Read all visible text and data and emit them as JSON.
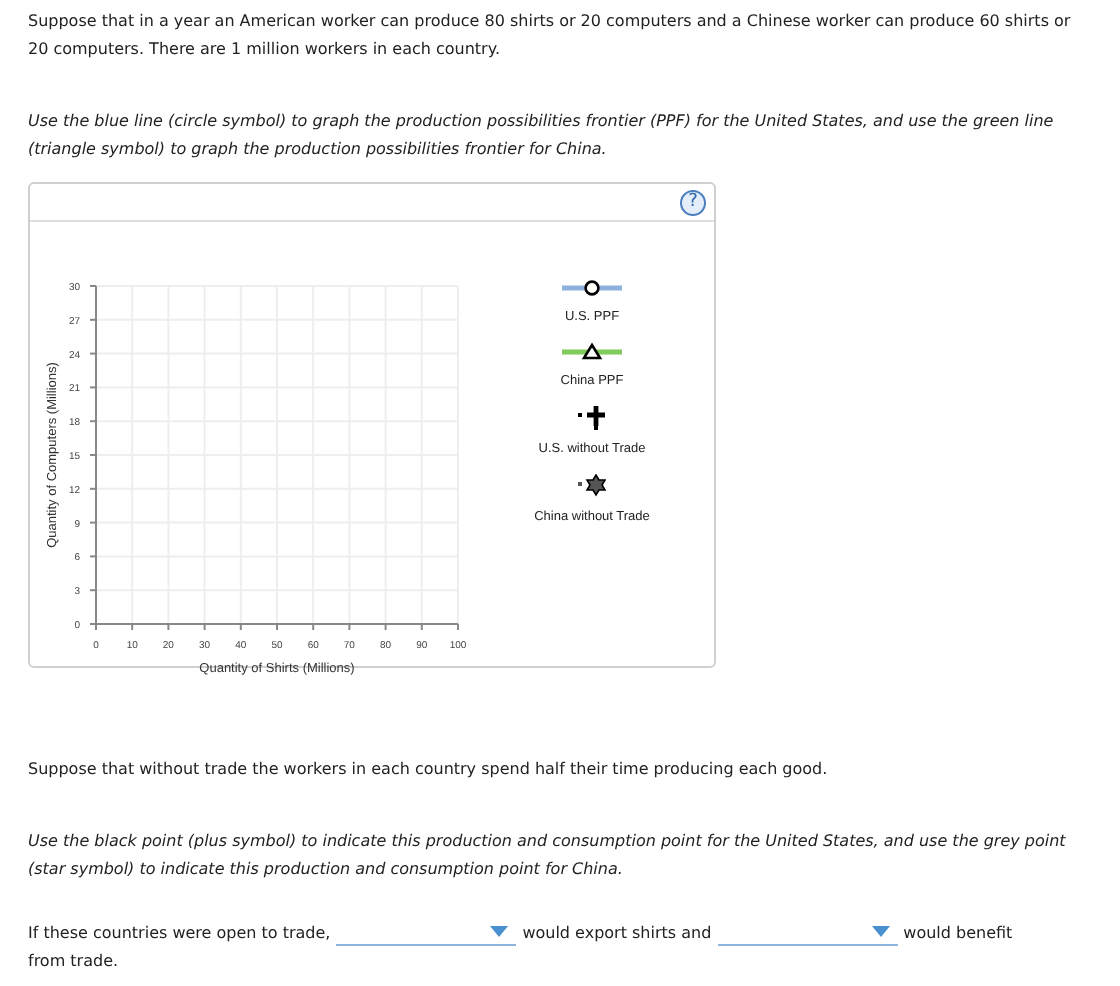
{
  "intro": "Suppose that in a year an American worker can produce 80 shirts or 20 computers and a Chinese worker can produce 60 shirts or 20 computers. There are 1 million workers in each country.",
  "instruction_1": "Use the blue line (circle symbol) to graph the production possibilities frontier (PPF) for the United States, and use the green line (triangle symbol) to graph the production possibilities frontier for China.",
  "graph": {
    "help": "?",
    "chart_data": {
      "type": "line",
      "grid": true,
      "xlabel": "Quantity of Shirts (Millions)",
      "ylabel": "Quantity of Computers (Millions)",
      "xlim": [
        0,
        100
      ],
      "ylim": [
        0,
        30
      ],
      "xticks": [
        0,
        10,
        20,
        30,
        40,
        50,
        60,
        70,
        80,
        90,
        100
      ],
      "yticks": [
        0,
        3,
        6,
        9,
        12,
        15,
        18,
        21,
        24,
        27,
        30
      ]
    },
    "legend": [
      {
        "kind": "circle",
        "label": "U.S. PPF",
        "color": "#8db3dc"
      },
      {
        "kind": "triangle",
        "label": "China PPF",
        "color": "#7fcc5c"
      },
      {
        "kind": "plus",
        "label": "U.S. without Trade",
        "color": "#000000"
      },
      {
        "kind": "star",
        "label": "China without Trade",
        "color": "#555555"
      }
    ]
  },
  "statement": "Suppose that without trade the workers in each country spend half their time producing each good.",
  "instruction_2": "Use the black point (plus symbol) to indicate this production and consumption point for the United States, and use the grey point (star symbol) to indicate this production and consumption point for China.",
  "question": [
    {
      "kind": "text",
      "text": "If these countries were open to trade,"
    },
    {
      "kind": "dropdown"
    },
    {
      "kind": "text",
      "text": "would export shirts and"
    },
    {
      "kind": "dropdown"
    },
    {
      "kind": "text",
      "text": "would benefit"
    },
    {
      "kind": "text",
      "text": "from trade."
    }
  ]
}
